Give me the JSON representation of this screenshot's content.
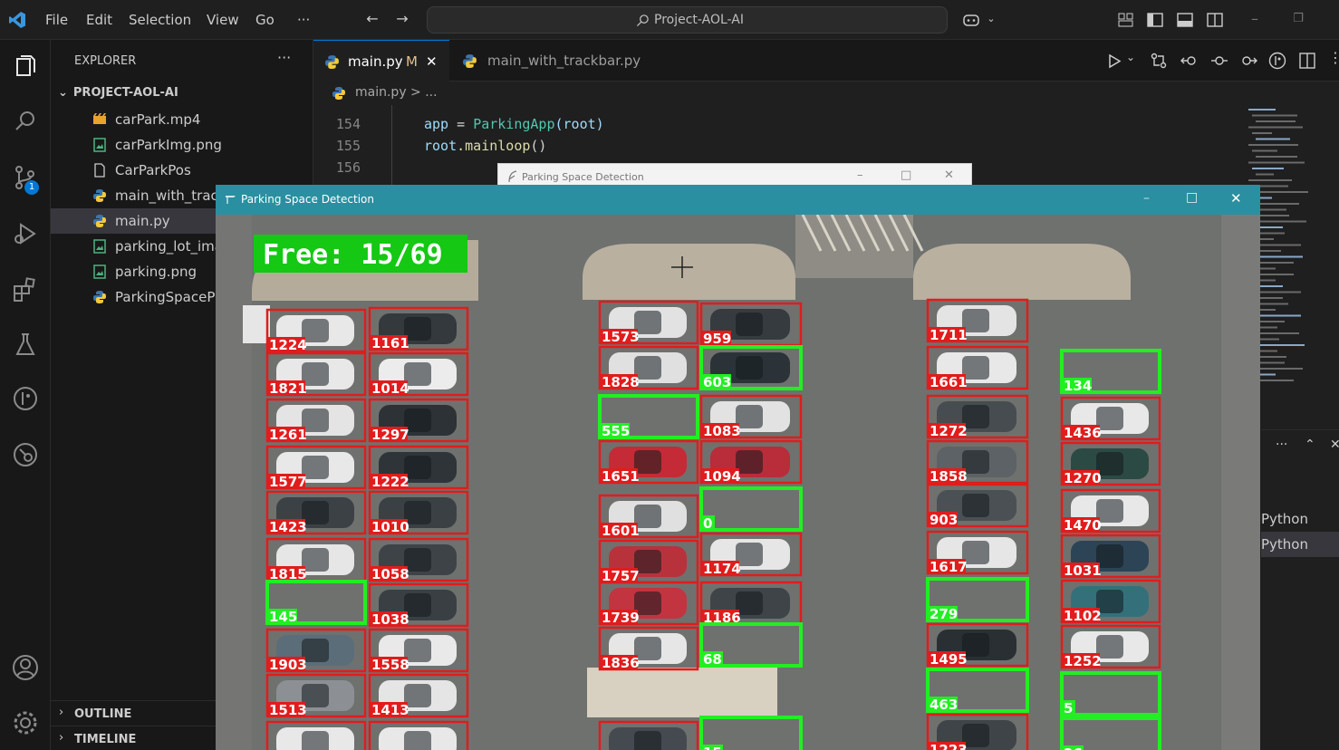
{
  "titlebar": {
    "menu": [
      "File",
      "Edit",
      "Selection",
      "View",
      "Go",
      "···"
    ],
    "search_text": "Project-AOL-AI"
  },
  "explorer": {
    "header": "EXPLORER",
    "more": "···",
    "root": "PROJECT-AOL-AI",
    "files": [
      {
        "name": "carPark.mp4",
        "icon": "video-file-icon"
      },
      {
        "name": "carParkImg.png",
        "icon": "image-file-icon"
      },
      {
        "name": "CarParkPos",
        "icon": "file-icon"
      },
      {
        "name": "main_with_track",
        "icon": "python-file-icon"
      },
      {
        "name": "main.py",
        "icon": "python-file-icon"
      },
      {
        "name": "parking_lot_ima",
        "icon": "image-file-icon"
      },
      {
        "name": "parking.png",
        "icon": "image-file-icon"
      },
      {
        "name": "ParkingSpacePi",
        "icon": "python-file-icon"
      }
    ],
    "outline": "OUTLINE",
    "timeline": "TIMELINE",
    "scm_badge": "1"
  },
  "editor": {
    "tabs": [
      {
        "name": "main.py",
        "status": "M"
      },
      {
        "name": "main_with_trackbar.py",
        "status": ""
      }
    ],
    "breadcrumb": "main.py > ...",
    "lines": [
      {
        "no": "154",
        "code": ""
      },
      {
        "no": "155",
        "code": ""
      },
      {
        "no": "156",
        "code": ""
      }
    ],
    "code_154_var": "app",
    "code_154_eq": " = ",
    "code_154_cls": "ParkingApp",
    "code_154_arg": "(root)",
    "code_155_var": "root",
    "code_155_fn": ".mainloop",
    "code_155_end": "()"
  },
  "right_panel": {
    "items": [
      "Python",
      "Python"
    ]
  },
  "back_window": {
    "title": "Parking Space Detection"
  },
  "front_window": {
    "title": "Parking Space Detection",
    "free_text": "Free: 15/69"
  },
  "colors": {
    "occupied": "#e11c1c",
    "free": "#22ee22",
    "accent": "#0078d4",
    "window_title": "#2a8fa0"
  }
}
